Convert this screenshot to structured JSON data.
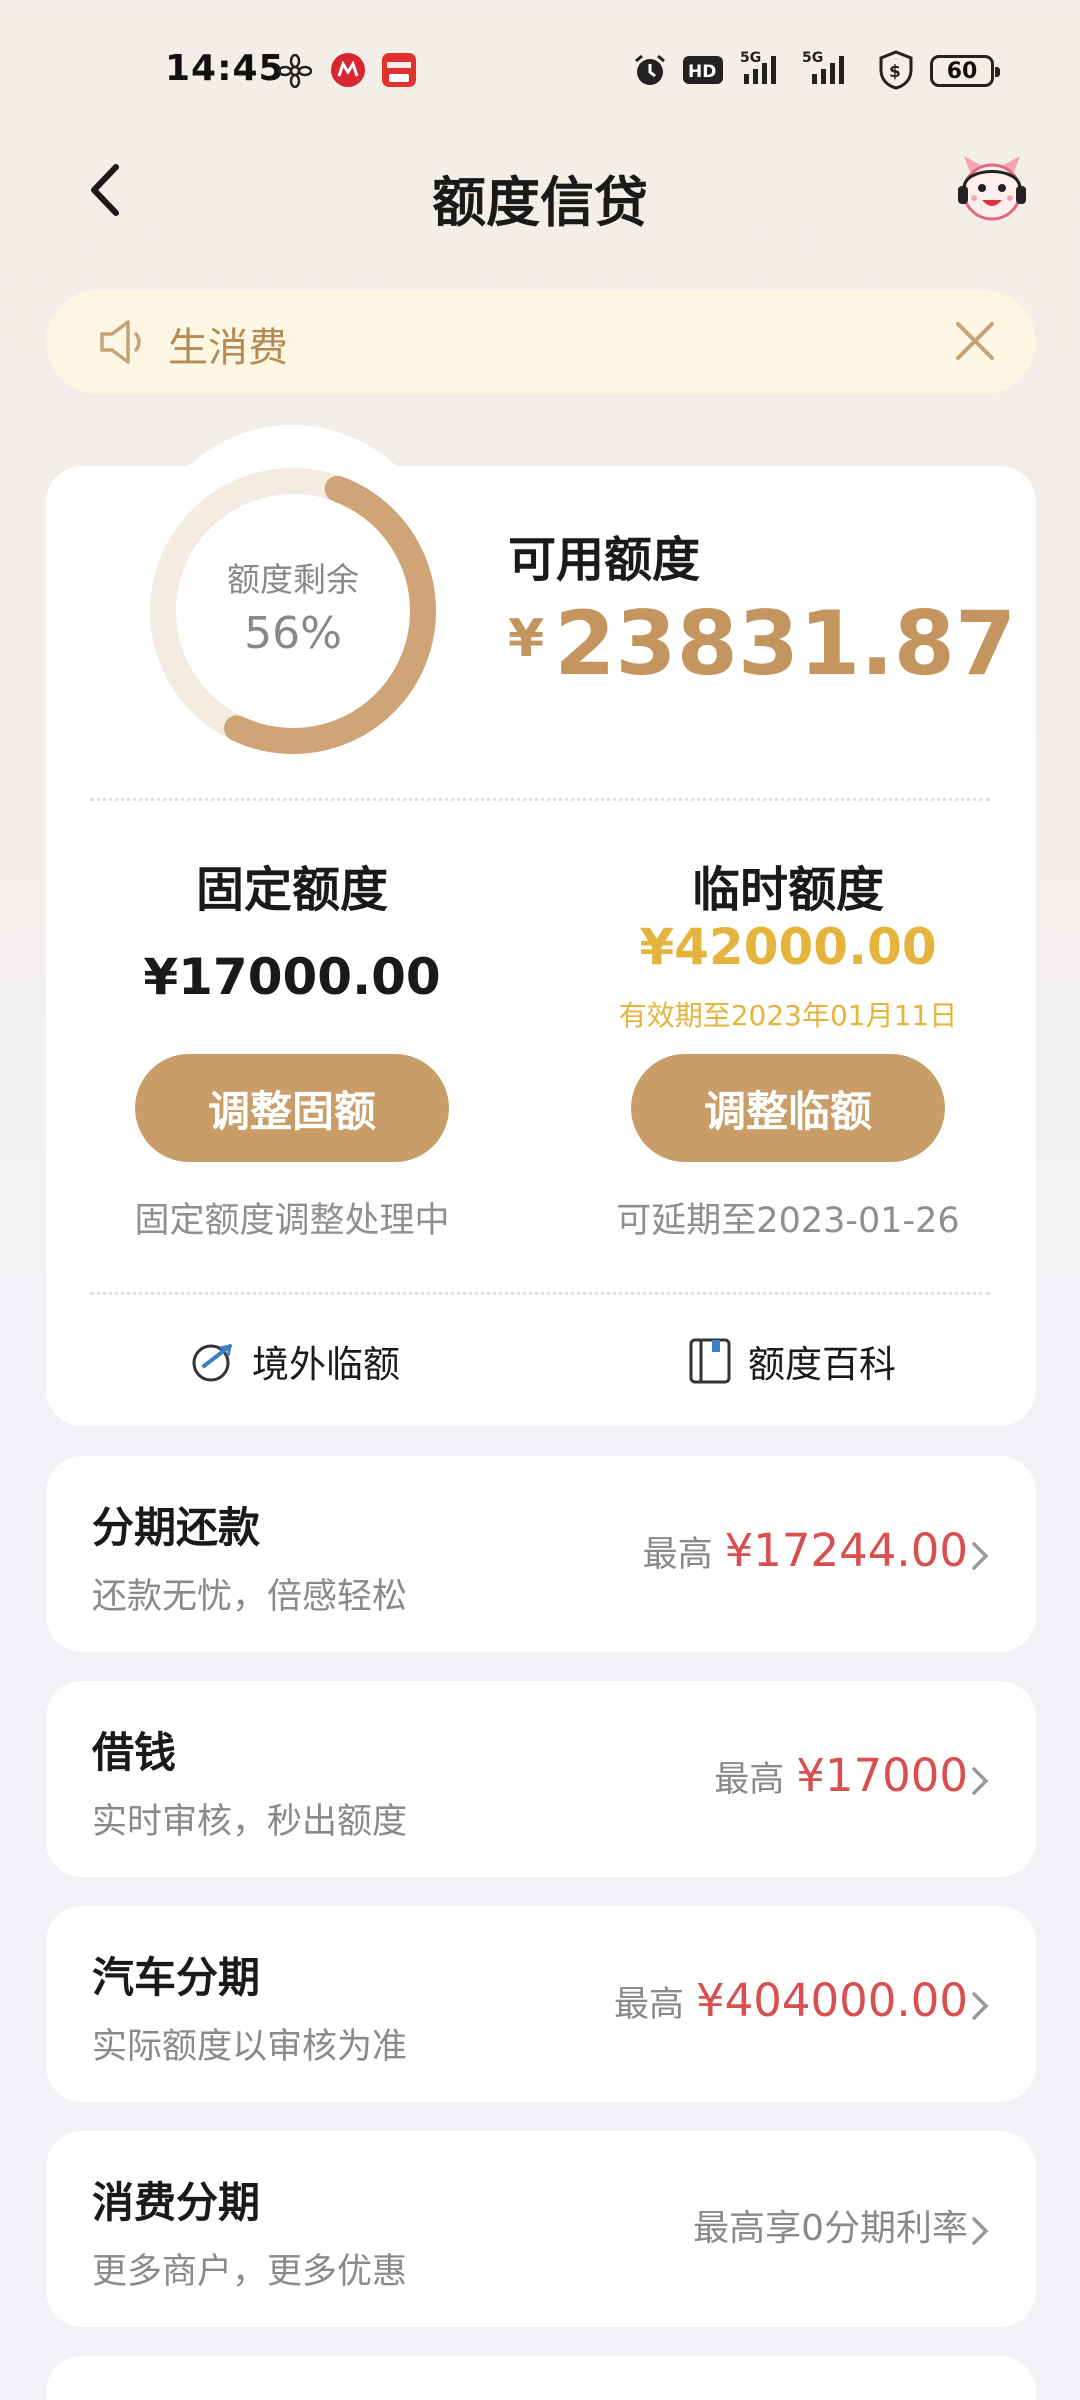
{
  "status_bar": {
    "time": "14:45",
    "battery": "60",
    "icons": [
      "flower-app-icon",
      "cmb-app-icon",
      "unionpay-app-icon",
      "alarm-icon",
      "hd-icon",
      "5g-signal-icon",
      "5g-signal-icon",
      "shield-dollar-icon",
      "battery-icon"
    ]
  },
  "header": {
    "title": "额度信贷"
  },
  "notice": {
    "text": "生消费"
  },
  "credit": {
    "ring_label": "额度剩余",
    "ring_percent": "56%",
    "ring_fraction": 0.56,
    "available_label": "可用额度",
    "available_currency": "¥",
    "available_amount": "23831.87",
    "fixed": {
      "title": "固定额度",
      "amount": "¥17000.00",
      "button": "调整固额",
      "note": "固定额度调整处理中"
    },
    "temporary": {
      "title": "临时额度",
      "amount": "¥42000.00",
      "expire": "有效期至2023年01月11日",
      "button": "调整临额",
      "note": "可延期至2023-01-26"
    },
    "links": {
      "overseas": "境外临额",
      "wiki": "额度百科"
    }
  },
  "products": [
    {
      "title": "分期还款",
      "subtitle": "还款无忧，倍感轻松",
      "prefix": "最高",
      "value": "¥17244.00"
    },
    {
      "title": "借钱",
      "subtitle": "实时审核，秒出额度",
      "prefix": "最高",
      "value": "¥17000"
    },
    {
      "title": "汽车分期",
      "subtitle": "实际额度以审核为准",
      "prefix": "最高",
      "value": "¥404000.00"
    },
    {
      "title": "消费分期",
      "subtitle": "更多商户，更多优惠",
      "prefix": "",
      "value": "最高享0分期利率"
    }
  ],
  "colors": {
    "accent_gold": "#c99d68",
    "amount_gold": "#c4955e",
    "temp_yellow": "#e4b43c",
    "price_red": "#d94e4e"
  }
}
